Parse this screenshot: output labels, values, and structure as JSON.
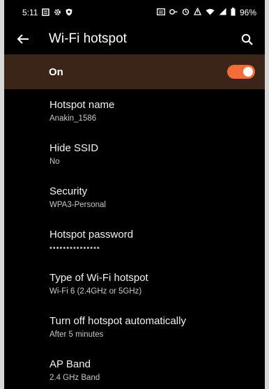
{
  "status_bar": {
    "time": "5:11",
    "battery_percent": "96%",
    "left_icons": [
      "notification-icon",
      "gear-icon",
      "shield-icon"
    ],
    "right_icons": [
      "cast-icon",
      "vpn-icon",
      "alarm-icon",
      "data-saver-icon",
      "wifi-icon",
      "signal-icon",
      "battery-icon"
    ]
  },
  "app_bar": {
    "title": "Wi-Fi hotspot",
    "back_icon": "back-arrow-icon",
    "search_icon": "search-icon"
  },
  "master_switch": {
    "label": "On",
    "checked": true,
    "accent_color": "#f26b3a",
    "background_color": "#3b2418"
  },
  "settings": [
    {
      "title": "Hotspot name",
      "summary": "Anakin_1586"
    },
    {
      "title": "Hide SSID",
      "summary": "No"
    },
    {
      "title": "Security",
      "summary": "WPA3-Personal"
    },
    {
      "title": "Hotspot password",
      "summary": "•••••••••••••••"
    },
    {
      "title": "Type of Wi-Fi hotspot",
      "summary": "Wi-Fi 6 (2.4GHz or 5GHz)"
    },
    {
      "title": "Turn off hotspot automatically",
      "summary": "After 5 minutes"
    },
    {
      "title": "AP Band",
      "summary": "2.4 GHz Band"
    }
  ]
}
